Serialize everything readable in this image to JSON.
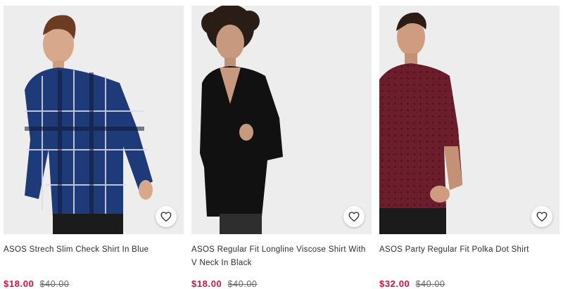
{
  "products": [
    {
      "title": "ASOS Strech Slim Check Shirt In Blue",
      "price": "$18.00",
      "was_price": "$40.00"
    },
    {
      "title": "ASOS Regular Fit Longline Viscose Shirt With V Neck In Black",
      "price": "$18.00",
      "was_price": "$40.00"
    },
    {
      "title": "ASOS Party Regular Fit Polka Dot Shirt",
      "price": "$32.00",
      "was_price": "$40.00"
    }
  ],
  "icons": {
    "save": "heart-outline-icon"
  },
  "colors": {
    "sale_price": "#d01345",
    "was_price": "#666666",
    "photo_bg": "#eeeeee"
  }
}
